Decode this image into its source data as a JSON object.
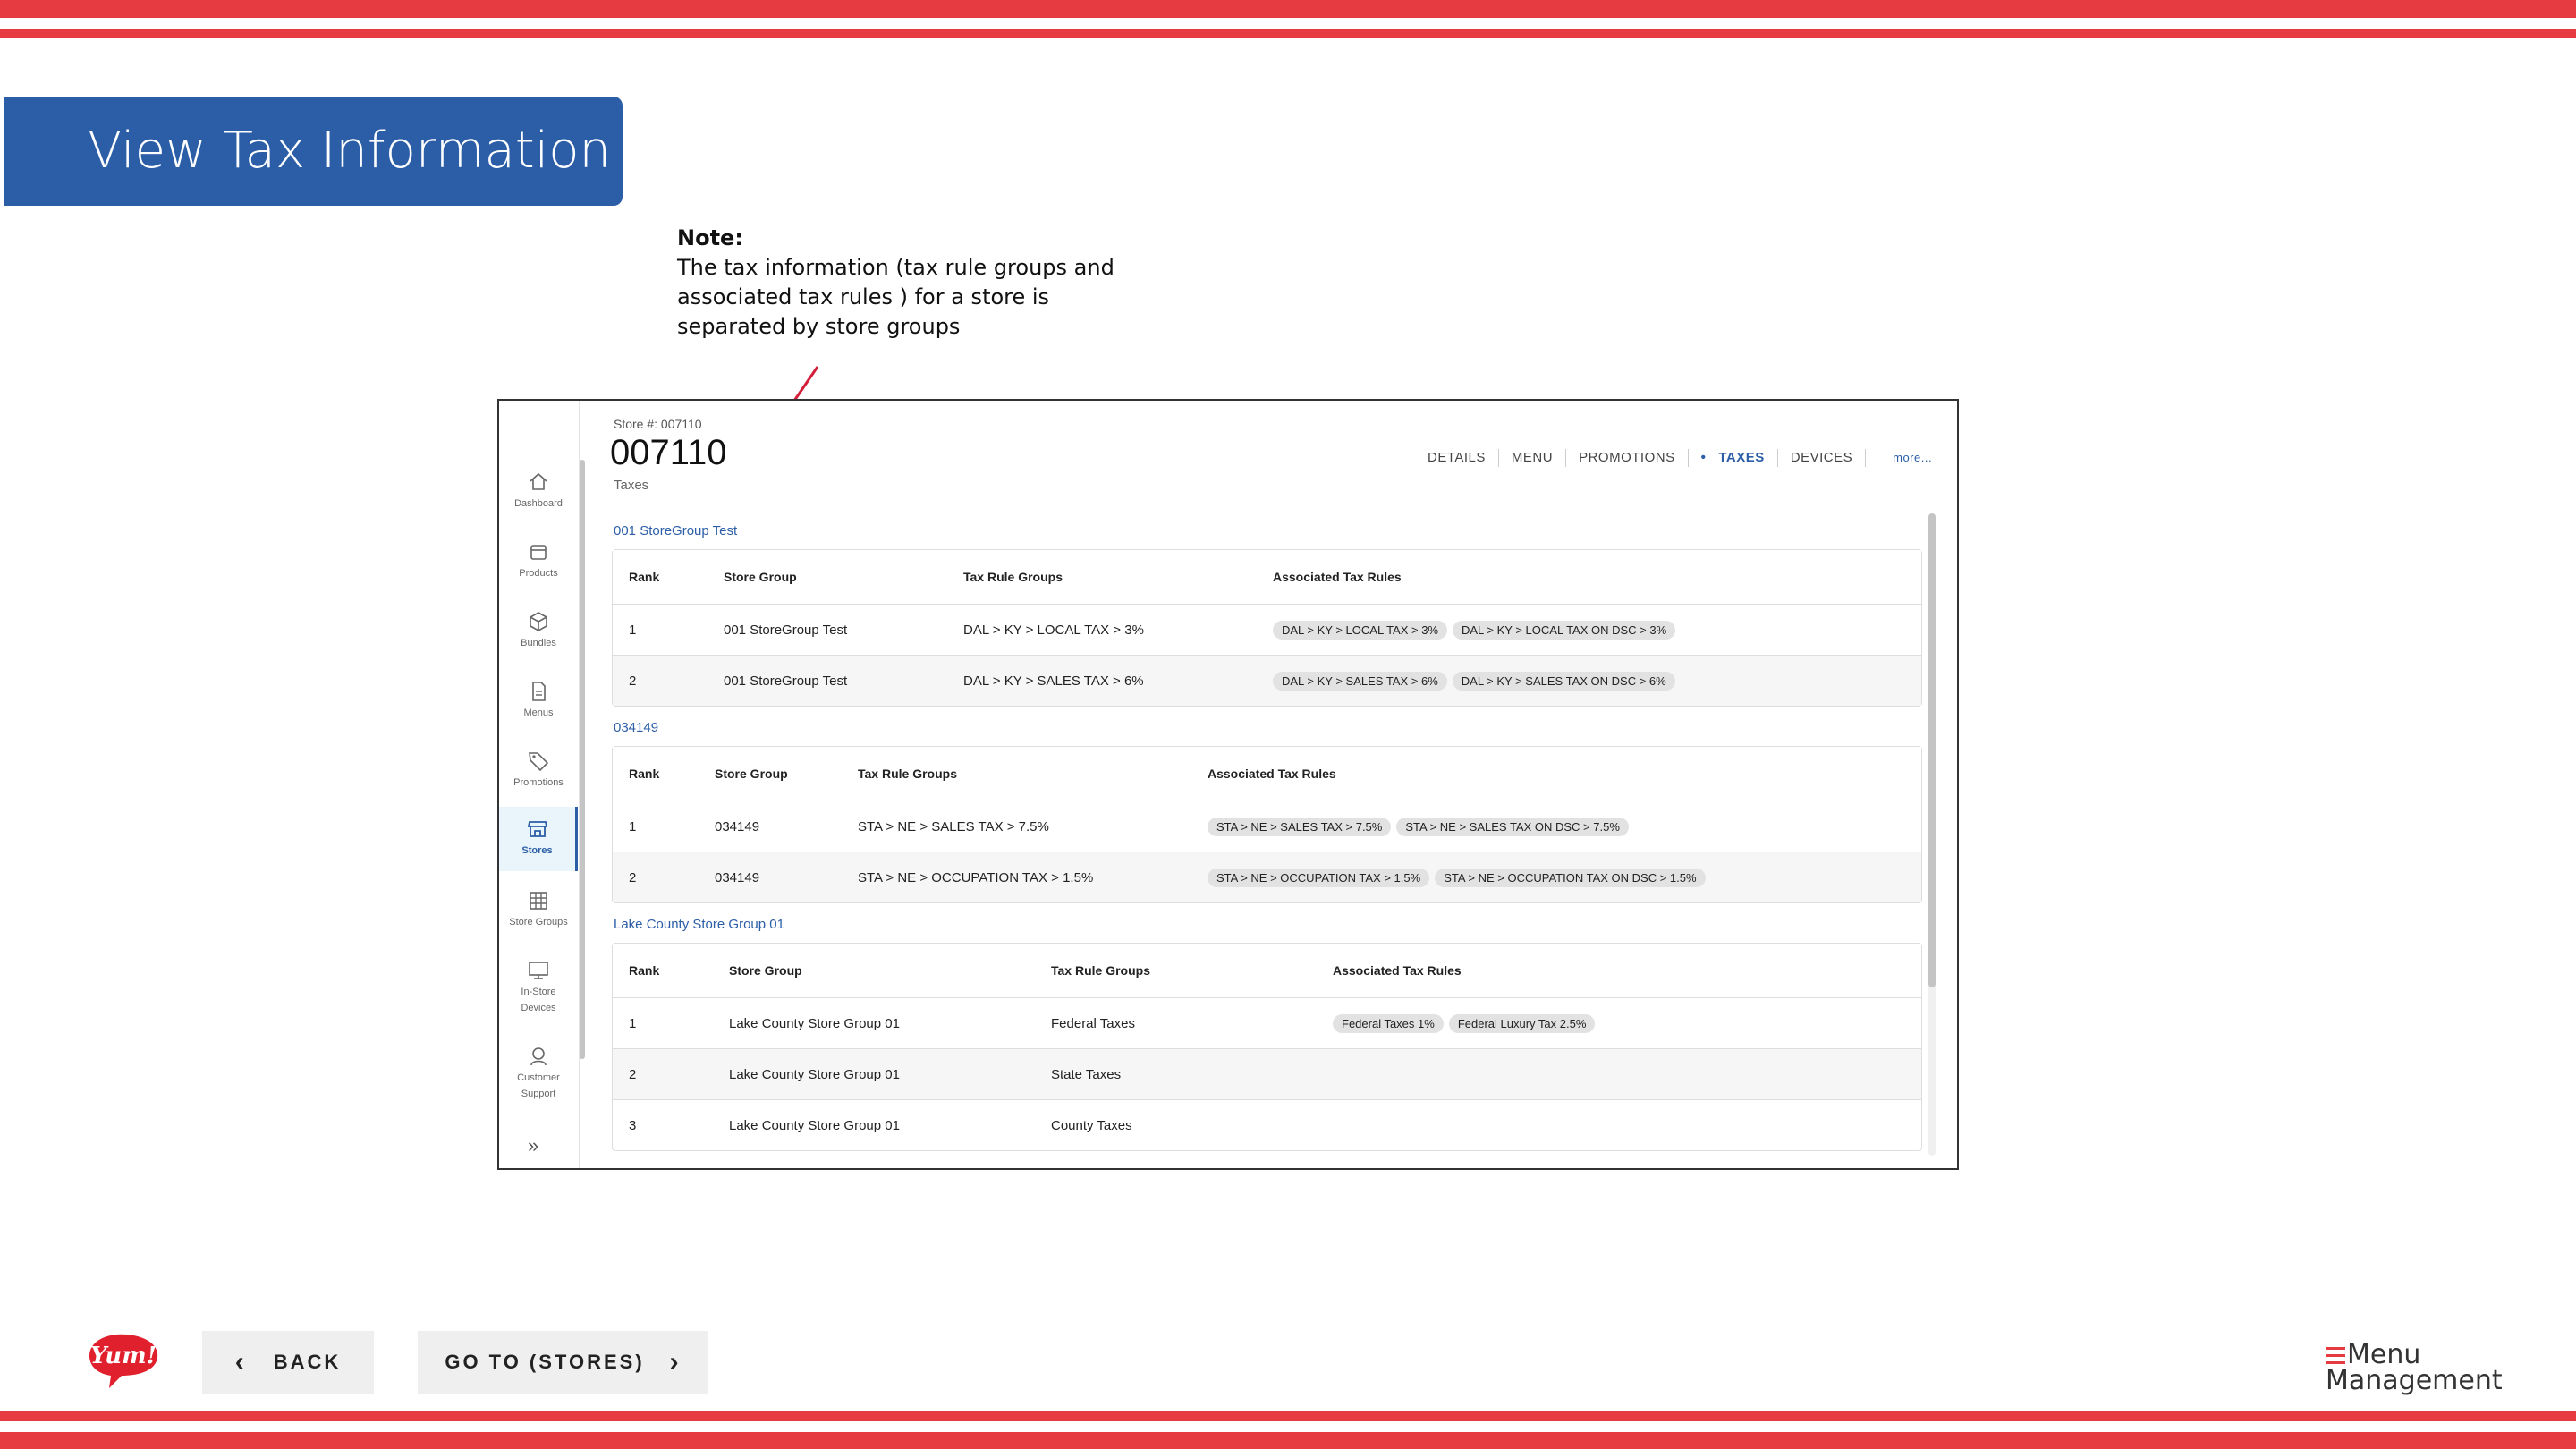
{
  "slide": {
    "title": "View Tax Information",
    "note_title": "Note:",
    "note_body": "The tax information (tax rule groups and associated tax rules ) for a store is separated by store groups"
  },
  "colors": {
    "accent_red": "#e63b41",
    "title_blue": "#2b5ea7",
    "link_blue": "#2b5ea7"
  },
  "sidebar": {
    "items": [
      {
        "label": "Dashboard",
        "icon": "home-icon"
      },
      {
        "label": "Products",
        "icon": "box-icon"
      },
      {
        "label": "Bundles",
        "icon": "cube-icon"
      },
      {
        "label": "Menus",
        "icon": "document-icon"
      },
      {
        "label": "Promotions",
        "icon": "tag-icon"
      },
      {
        "label": "Stores",
        "icon": "store-icon",
        "active": true
      },
      {
        "label": "Store Groups",
        "icon": "grid-icon"
      },
      {
        "label": "In-Store Devices",
        "line1": "In-Store",
        "line2": "Devices",
        "icon": "monitor-icon"
      },
      {
        "label": "Customer Support",
        "line1": "Customer",
        "line2": "Support",
        "icon": "support-icon"
      }
    ],
    "expand": "»"
  },
  "store": {
    "number_label": "Store #: 007110",
    "number": "007110",
    "section": "Taxes"
  },
  "tabs": [
    "DETAILS",
    "MENU",
    "PROMOTIONS",
    "TAXES",
    "DEVICES"
  ],
  "active_tab": "TAXES",
  "more_label": "more...",
  "headers": {
    "rank": "Rank",
    "store_group": "Store Group",
    "tax_rule_groups": "Tax Rule Groups",
    "associated_tax_rules": "Associated Tax Rules"
  },
  "groups": [
    {
      "title": "001 StoreGroup Test",
      "rows": [
        {
          "rank": "1",
          "store_group": "001 StoreGroup Test",
          "tax_rule_group": "DAL > KY > LOCAL TAX > 3%",
          "rules": [
            "DAL > KY > LOCAL TAX > 3%",
            "DAL > KY > LOCAL TAX ON DSC > 3%"
          ]
        },
        {
          "rank": "2",
          "store_group": "001 StoreGroup Test",
          "tax_rule_group": "DAL > KY > SALES TAX > 6%",
          "rules": [
            "DAL > KY > SALES TAX > 6%",
            "DAL > KY > SALES TAX ON DSC > 6%"
          ]
        }
      ]
    },
    {
      "title": "034149",
      "rows": [
        {
          "rank": "1",
          "store_group": "034149",
          "tax_rule_group": "STA > NE > SALES TAX > 7.5%",
          "rules": [
            "STA > NE > SALES TAX > 7.5%",
            "STA > NE > SALES TAX ON DSC > 7.5%"
          ]
        },
        {
          "rank": "2",
          "store_group": "034149",
          "tax_rule_group": "STA > NE > OCCUPATION TAX > 1.5%",
          "rules": [
            "STA > NE > OCCUPATION TAX > 1.5%",
            "STA > NE > OCCUPATION TAX ON DSC > 1.5%"
          ]
        }
      ]
    },
    {
      "title": "Lake County Store Group 01",
      "rows": [
        {
          "rank": "1",
          "store_group": "Lake County Store Group 01",
          "tax_rule_group": "Federal Taxes",
          "rules": [
            "Federal Taxes 1%",
            "Federal Luxury Tax 2.5%"
          ]
        },
        {
          "rank": "2",
          "store_group": "Lake County Store Group 01",
          "tax_rule_group": "State Taxes",
          "rules": []
        },
        {
          "rank": "3",
          "store_group": "Lake County Store Group 01",
          "tax_rule_group": "County Taxes",
          "rules": []
        }
      ]
    }
  ],
  "footer": {
    "back_label": "BACK",
    "goto_label": "GO TO (STORES)",
    "brand_logo": "Yum!",
    "product_logo_line1": "Menu",
    "product_logo_line2": "Management"
  }
}
